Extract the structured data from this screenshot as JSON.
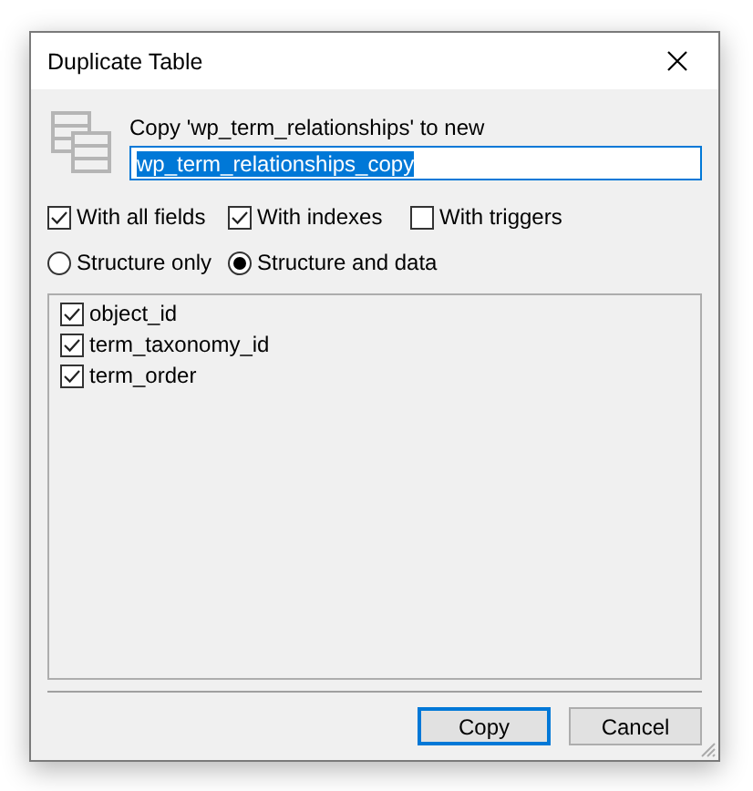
{
  "window": {
    "title": "Duplicate Table"
  },
  "copy_label": "Copy 'wp_term_relationships' to new",
  "name_field": {
    "value": "wp_term_relationships_copy",
    "value_selected": true
  },
  "options": [
    {
      "label": "With all fields",
      "checked": true
    },
    {
      "label": "With indexes",
      "checked": true
    },
    {
      "label": "With triggers",
      "checked": false
    }
  ],
  "modes": [
    {
      "label": "Structure only",
      "selected": false
    },
    {
      "label": "Structure and data",
      "selected": true
    }
  ],
  "fields": [
    {
      "label": "object_id",
      "checked": true
    },
    {
      "label": "term_taxonomy_id",
      "checked": true
    },
    {
      "label": "term_order",
      "checked": true
    }
  ],
  "buttons": [
    {
      "label": "Copy",
      "default": true
    },
    {
      "label": "Cancel",
      "default": false
    }
  ]
}
